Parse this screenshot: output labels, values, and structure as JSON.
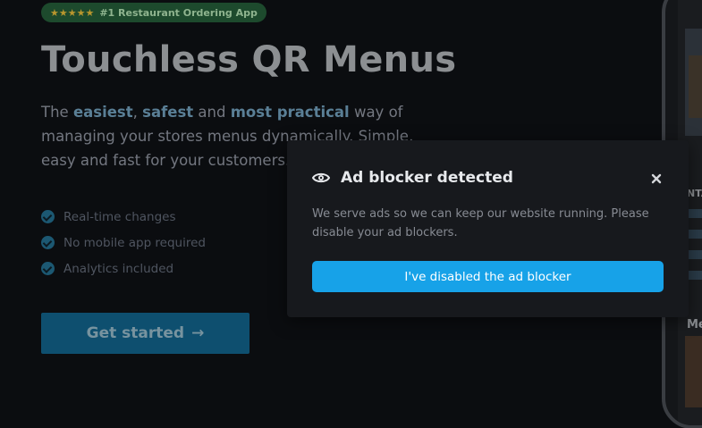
{
  "badge": {
    "stars": "★★★★★",
    "text": "#1 Restaurant Ordering App"
  },
  "hero": {
    "title": "Touchless QR Menus",
    "desc": {
      "p1": "The ",
      "b1": "easiest",
      "p2": ", ",
      "b2": "safest",
      "p3": " and ",
      "b3": "most practical",
      "p4": " way of managing your stores menus dynamically. Simple, easy and fast for your customers."
    },
    "features": [
      "Real-time changes",
      "No mobile app required",
      "Analytics included"
    ],
    "cta_label": "Get started",
    "cta_arrow": "→"
  },
  "phone": {
    "text_fragments": [
      "NTA",
      "Me"
    ]
  },
  "modal": {
    "title": "Ad blocker detected",
    "message": "We serve ads so we can keep our website running. Please disable your ad blockers.",
    "button_label": "I've disabled the ad blocker"
  },
  "colors": {
    "accent": "#17a2e8",
    "badge_bg": "#1d4a2d",
    "modal_bg": "#17191d"
  }
}
